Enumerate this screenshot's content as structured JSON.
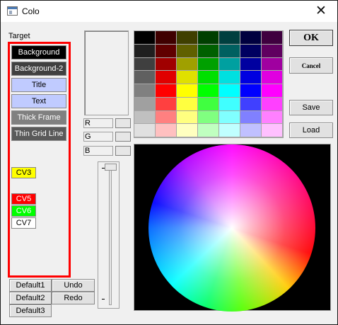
{
  "window": {
    "title": "Colo",
    "close_glyph": "✕",
    "icon": "app-window-icon"
  },
  "target": {
    "label": "Target",
    "items": [
      {
        "label": "Background",
        "bg": "#000000",
        "fg": "#ffffff"
      },
      {
        "label": "Background-2",
        "bg": "#404040",
        "fg": "#ffffff"
      },
      {
        "label": "Title",
        "bg": "#c0cbff",
        "fg": "#000000"
      },
      {
        "label": "Text",
        "bg": "#c0cbff",
        "fg": "#000000"
      },
      {
        "label": "Thick Frame",
        "bg": "#808080",
        "fg": "#ffffff"
      },
      {
        "label": "Thin Grid Line",
        "bg": "#5a5a5a",
        "fg": "#ffffff"
      }
    ],
    "custom": [
      {
        "label": "CV3",
        "bg": "#ffff00",
        "fg": "#000000"
      },
      {
        "label": "CV5",
        "bg": "#ff0000",
        "fg": "#ffffff"
      },
      {
        "label": "CV6",
        "bg": "#00ff00",
        "fg": "#ffffff"
      },
      {
        "label": "CV7",
        "bg": "#ffffff",
        "fg": "#000000"
      }
    ],
    "highlight_color": "#ff0000"
  },
  "rgb": {
    "r_label": "R",
    "g_label": "G",
    "b_label": "B"
  },
  "buttons": {
    "ok": "OK",
    "cancel": "Cancel",
    "save": "Save",
    "load": "Load"
  },
  "bottom_buttons": {
    "default1": "Default1",
    "undo": "Undo",
    "default2": "Default2",
    "redo": "Redo",
    "default3": "Default3"
  },
  "palette": [
    [
      "#000000",
      "#3f0000",
      "#3f3f00",
      "#003f00",
      "#003f3f",
      "#00003f",
      "#3f003f"
    ],
    [
      "#1f1f1f",
      "#600000",
      "#606000",
      "#006000",
      "#006060",
      "#000060",
      "#600060"
    ],
    [
      "#3f3f3f",
      "#a00000",
      "#a0a000",
      "#00a000",
      "#00a0a0",
      "#0000a0",
      "#a000a0"
    ],
    [
      "#606060",
      "#e00000",
      "#e0e000",
      "#00e000",
      "#00e0e0",
      "#0000e0",
      "#e000e0"
    ],
    [
      "#808080",
      "#ff0000",
      "#ffff00",
      "#00ff00",
      "#00ffff",
      "#0000ff",
      "#ff00ff"
    ],
    [
      "#a0a0a0",
      "#ff4040",
      "#ffff40",
      "#40ff40",
      "#40ffff",
      "#4040ff",
      "#ff40ff"
    ],
    [
      "#c0c0c0",
      "#ff8080",
      "#ffff80",
      "#80ff80",
      "#80ffff",
      "#8080ff",
      "#ff80ff"
    ],
    [
      "#e0e0e0",
      "#ffc0c0",
      "#ffffc0",
      "#c0ffc0",
      "#c0ffff",
      "#c0c0ff",
      "#ffc0ff"
    ]
  ],
  "slider": {
    "top_mark": "-",
    "bottom_mark": "-"
  }
}
